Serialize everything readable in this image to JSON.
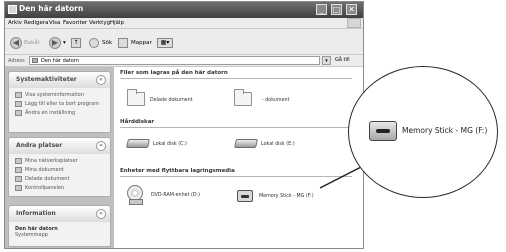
{
  "window": {
    "title": "Den här datorn",
    "controls": [
      "_",
      "□",
      "✕"
    ]
  },
  "menubar": {
    "items": [
      "Arkiv",
      "Redigera",
      "Visa",
      "Favoriter",
      "Verktyg",
      "Hjälp"
    ]
  },
  "toolbar": {
    "back_label": "Bakåt",
    "search_label": "Sök",
    "folders_label": "Mappar",
    "views_glyph": "▦▾"
  },
  "addressbar": {
    "label": "Adress",
    "value": "Den här datorn",
    "go_label": "Gå till"
  },
  "sidebar": {
    "system_tasks": {
      "title": "Systemaktiviteter",
      "items": [
        "Visa systeminformation",
        "Lägg till eller ta bort program",
        "Ändra en inställning"
      ]
    },
    "other_places": {
      "title": "Andra platser",
      "items": [
        "Mina nätverksplatser",
        "Mina dokument",
        "Delade dokument",
        "Kontrollpanelen"
      ]
    },
    "information": {
      "title": "Information",
      "name": "Den här datorn",
      "type": "Systemmapp"
    }
  },
  "content": {
    "stored_files": {
      "heading": "Filer som lagras på den här datorn",
      "items": [
        "Delade dokument",
        "- dokument"
      ]
    },
    "hard_disks": {
      "heading": "Hårddiskar",
      "items": [
        "Lokal disk (C:)",
        "Lokal disk (E:)"
      ]
    },
    "removable": {
      "heading": "Enheter med flyttbara lagringsmedia",
      "items": [
        "DVD-RAM-enhet (D:)",
        "Memory Stick - MG (F:)"
      ]
    }
  },
  "callout": {
    "label": "Memory Stick - MG (F:)"
  }
}
